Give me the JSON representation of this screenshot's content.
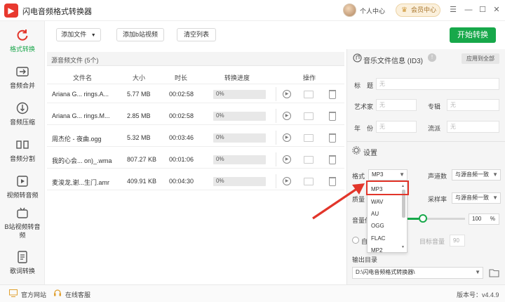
{
  "app": {
    "title": "闪电音频格式转换器",
    "user_center": "个人中心",
    "vip": "会员中心"
  },
  "sidebar": {
    "items": [
      {
        "label": "格式转换",
        "icon": "refresh-icon"
      },
      {
        "label": "音频合并",
        "icon": "merge-icon"
      },
      {
        "label": "音频压缩",
        "icon": "compress-icon"
      },
      {
        "label": "音频分割",
        "icon": "split-icon"
      },
      {
        "label": "视频转音频",
        "icon": "video-audio-icon"
      },
      {
        "label": "B站视频转音频",
        "icon": "bilibili-icon"
      },
      {
        "label": "歌词转换",
        "icon": "lyrics-icon"
      }
    ],
    "active": 0
  },
  "toolbar": {
    "add_file": "添加文件",
    "add_bilibili": "添加b站视频",
    "clear_list": "清空列表",
    "start": "开始转换"
  },
  "filelist": {
    "title": "源音频文件 (5个)",
    "columns": [
      "文件名",
      "大小",
      "时长",
      "转换进度",
      "操作"
    ],
    "rows": [
      {
        "name": "Ariana G... rings.A...",
        "size": "5.77 MB",
        "duration": "00:02:58",
        "progress": "0%"
      },
      {
        "name": "Ariana G... rings.M...",
        "size": "2.85 MB",
        "duration": "00:02:58",
        "progress": "0%"
      },
      {
        "name": "周杰伦 - 夜曲.ogg",
        "size": "5.32 MB",
        "duration": "00:03:46",
        "progress": "0%"
      },
      {
        "name": "我的心会... on)_.wma",
        "size": "807.27 KB",
        "duration": "00:01:06",
        "progress": "0%"
      },
      {
        "name": "麦浚龙,谢...生门.amr",
        "size": "409.91 KB",
        "duration": "00:04:30",
        "progress": "0%"
      }
    ]
  },
  "id3": {
    "header": "音乐文件信息 (ID3)",
    "apply_all": "应用到全部",
    "title_label": "标　题",
    "artist_label": "艺术家",
    "album_label": "专辑",
    "year_label": "年　份",
    "genre_label": "流派",
    "placeholder": "无"
  },
  "settings": {
    "header": "设置",
    "format_label": "格式",
    "format_value": "MP3",
    "channels_label": "声道数",
    "channels_value": "与源音频一致",
    "sample_label": "采样率",
    "sample_value": "与源音频一致",
    "quality_label": "质量",
    "volume_label": "音量倍",
    "volume_value": "100",
    "volume_unit": "%",
    "volume_level": 1.0,
    "auto_label": "自",
    "target_volume_label": "目标音量",
    "target_volume_value": "90",
    "output_label": "输出目录",
    "output_path": "D:\\闪电音频格式转换器\\"
  },
  "dropdown": {
    "options": [
      "MP3",
      "WAV",
      "AU",
      "OGG",
      "FLAC",
      "MP2"
    ],
    "selected": "MP3"
  },
  "bottom": {
    "website": "官方网站",
    "support": "在线客服",
    "version": "版本号：v4.4.9"
  },
  "colors": {
    "accent": "#17a84a",
    "highlight": "#e2352a",
    "vip": "#a7742a"
  }
}
